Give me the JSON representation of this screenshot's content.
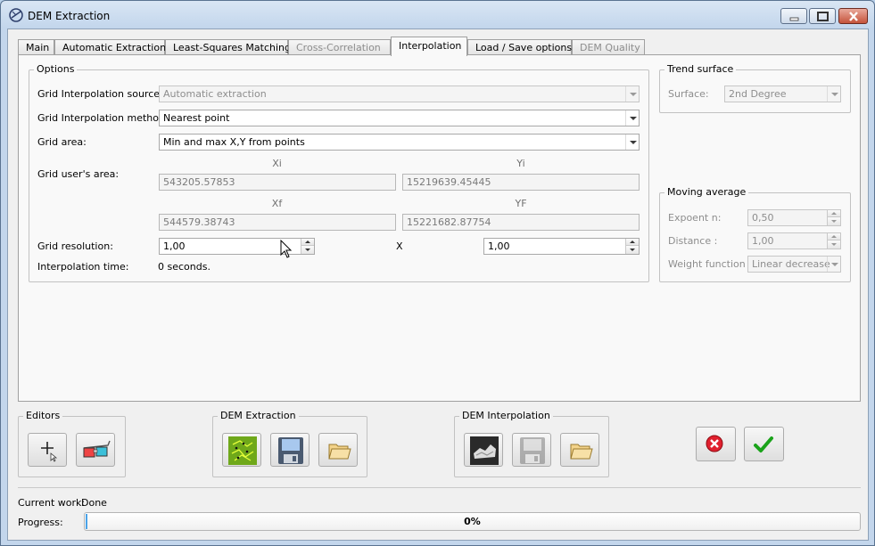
{
  "window": {
    "title": "DEM Extraction"
  },
  "tabs": [
    {
      "label": "Main",
      "enabled": true
    },
    {
      "label": "Automatic Extraction",
      "enabled": true
    },
    {
      "label": "Least-Squares Matching",
      "enabled": true
    },
    {
      "label": "Cross-Correlation",
      "enabled": false
    },
    {
      "label": "Interpolation",
      "enabled": true,
      "active": true
    },
    {
      "label": "Load / Save options",
      "enabled": true
    },
    {
      "label": "DEM Quality",
      "enabled": false
    }
  ],
  "options": {
    "title": "Options",
    "source_label": "Grid Interpolation source:",
    "source_value": "Automatic extraction",
    "method_label": "Grid Interpolation method:",
    "method_value": "Nearest point",
    "area_label": "Grid area:",
    "area_value": "Min and max X,Y from points",
    "user_area_label": "Grid user's area:",
    "xi_label": "Xi",
    "xi_value": "543205.57853",
    "yi_label": "Yi",
    "yi_value": "15219639.45445",
    "xf_label": "Xf",
    "xf_value": "544579.38743",
    "yf_label": "YF",
    "yf_value": "15221682.87754",
    "resolution_label": "Grid resolution:",
    "resolution_x": "1,00",
    "resolution_sep": "X",
    "resolution_y": "1,00",
    "time_label": "Interpolation time:",
    "time_value": "0 seconds."
  },
  "trend_surface": {
    "title": "Trend surface",
    "surface_label": "Surface:",
    "surface_value": "2nd Degree"
  },
  "moving_average": {
    "title": "Moving average",
    "exponent_label": "Expoent n:",
    "exponent_value": "0,50",
    "distance_label": "Distance :",
    "distance_value": "1,00",
    "weight_label": "Weight function :",
    "weight_value": "Linear decrease"
  },
  "toolbars": {
    "editors_title": "Editors",
    "dem_extraction_title": "DEM Extraction",
    "dem_interpolation_title": "DEM Interpolation"
  },
  "status": {
    "current_work_label": "Current work:",
    "current_work_value": "Done",
    "progress_label": "Progress:",
    "progress_text": "0%",
    "progress_fraction": 0.0
  },
  "icons": {
    "app": "efoto-logo-icon",
    "add_point": "add-point-icon",
    "stereo": "stereo-glasses-icon",
    "extraction_map": "point-cloud-icon",
    "extraction_save": "save-disk-icon",
    "extraction_open": "folder-open-icon",
    "interp_view": "dem-view-icon",
    "interp_save": "save-disk-icon",
    "interp_open": "folder-open-icon",
    "cancel": "cancel-icon",
    "ok": "checkmark-icon"
  },
  "colors": {
    "accent": "#4aa3e8",
    "cancel": "#e0202e",
    "ok": "#1aa31a"
  }
}
